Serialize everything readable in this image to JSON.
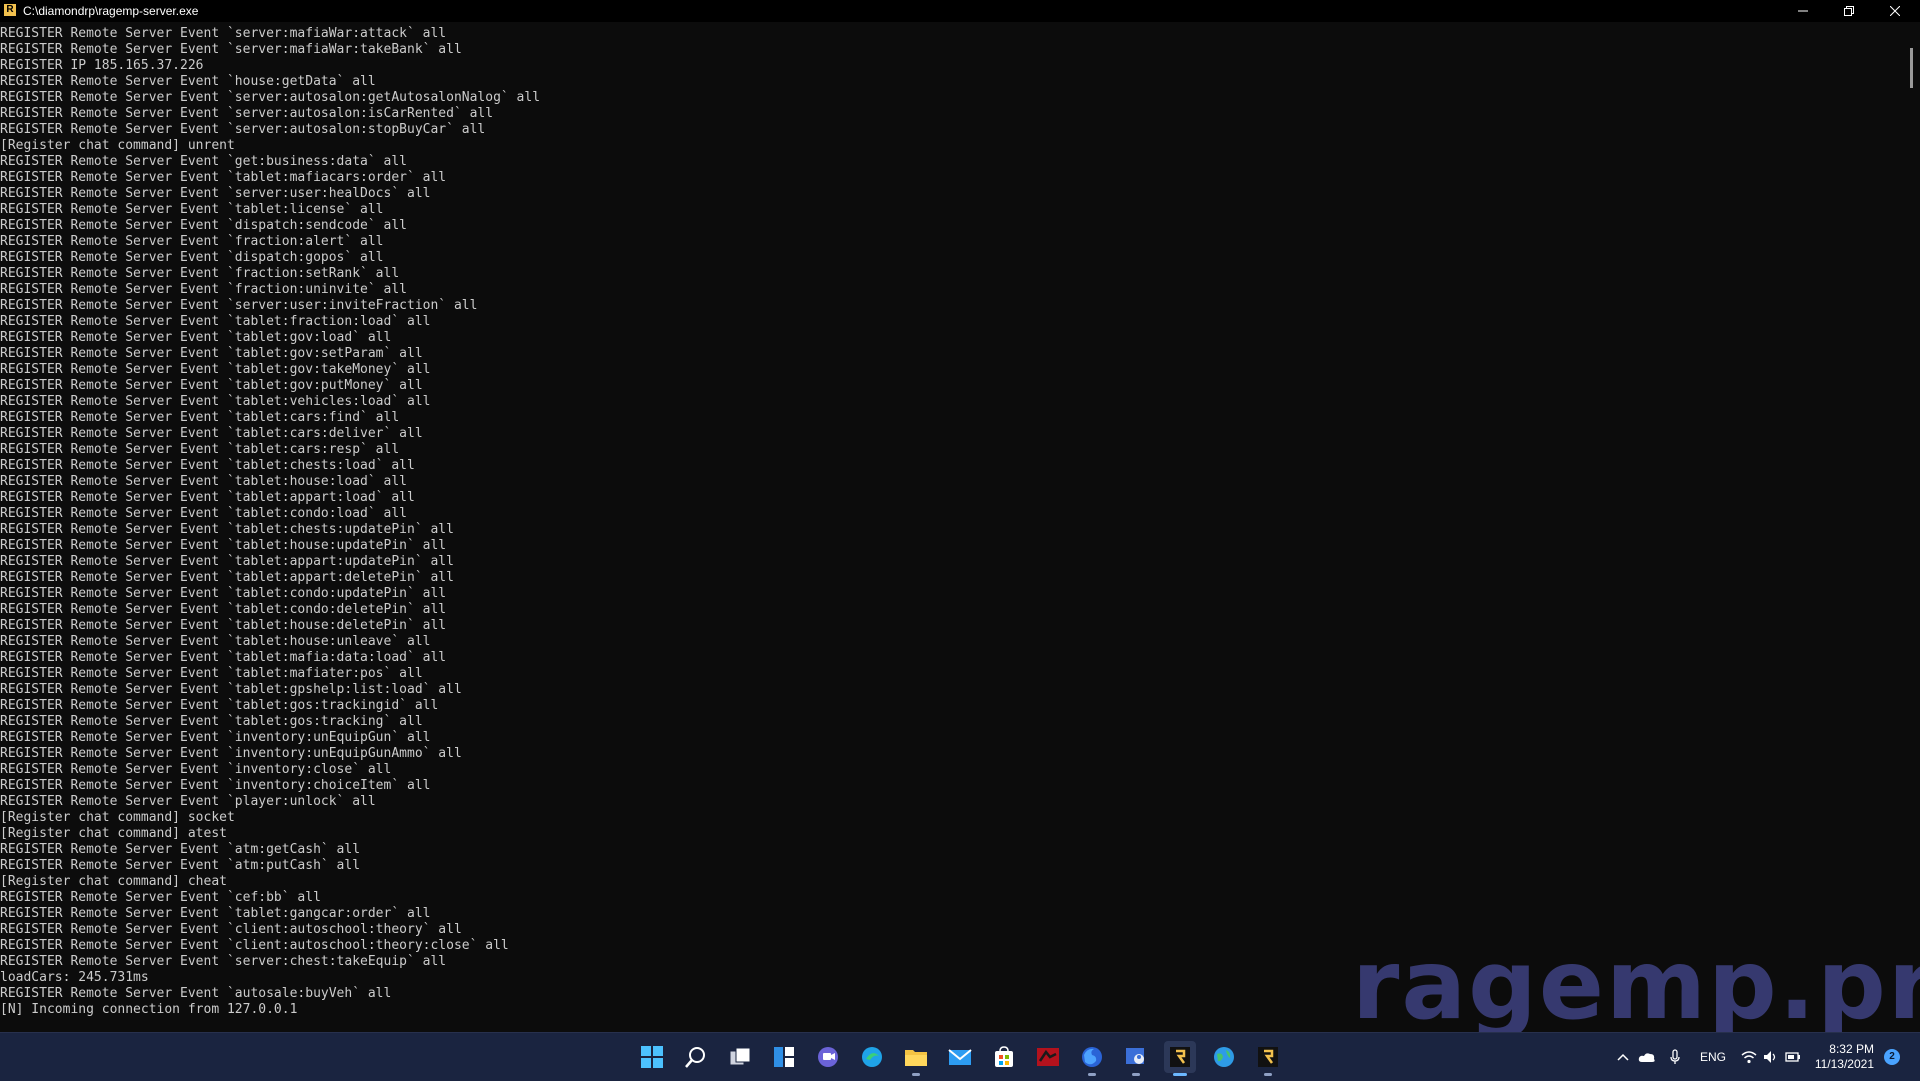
{
  "window": {
    "title": "C:\\diamondrp\\ragemp-server.exe",
    "controls": {
      "minimize": "minimize-icon",
      "restore": "restore-icon",
      "close": "close-icon"
    }
  },
  "console": {
    "lines": [
      "REGISTER Remote Server Event `server:mafiaWar:attack` all",
      "REGISTER Remote Server Event `server:mafiaWar:takeBank` all",
      "REGISTER IP 185.165.37.226",
      "REGISTER Remote Server Event `house:getData` all",
      "REGISTER Remote Server Event `server:autosalon:getAutosalonNalog` all",
      "REGISTER Remote Server Event `server:autosalon:isCarRented` all",
      "REGISTER Remote Server Event `server:autosalon:stopBuyCar` all",
      "[Register chat command] unrent",
      "REGISTER Remote Server Event `get:business:data` all",
      "REGISTER Remote Server Event `tablet:mafiacars:order` all",
      "REGISTER Remote Server Event `server:user:healDocs` all",
      "REGISTER Remote Server Event `tablet:license` all",
      "REGISTER Remote Server Event `dispatch:sendcode` all",
      "REGISTER Remote Server Event `fraction:alert` all",
      "REGISTER Remote Server Event `dispatch:gopos` all",
      "REGISTER Remote Server Event `fraction:setRank` all",
      "REGISTER Remote Server Event `fraction:uninvite` all",
      "REGISTER Remote Server Event `server:user:inviteFraction` all",
      "REGISTER Remote Server Event `tablet:fraction:load` all",
      "REGISTER Remote Server Event `tablet:gov:load` all",
      "REGISTER Remote Server Event `tablet:gov:setParam` all",
      "REGISTER Remote Server Event `tablet:gov:takeMoney` all",
      "REGISTER Remote Server Event `tablet:gov:putMoney` all",
      "REGISTER Remote Server Event `tablet:vehicles:load` all",
      "REGISTER Remote Server Event `tablet:cars:find` all",
      "REGISTER Remote Server Event `tablet:cars:deliver` all",
      "REGISTER Remote Server Event `tablet:cars:resp` all",
      "REGISTER Remote Server Event `tablet:chests:load` all",
      "REGISTER Remote Server Event `tablet:house:load` all",
      "REGISTER Remote Server Event `tablet:appart:load` all",
      "REGISTER Remote Server Event `tablet:condo:load` all",
      "REGISTER Remote Server Event `tablet:chests:updatePin` all",
      "REGISTER Remote Server Event `tablet:house:updatePin` all",
      "REGISTER Remote Server Event `tablet:appart:updatePin` all",
      "REGISTER Remote Server Event `tablet:appart:deletePin` all",
      "REGISTER Remote Server Event `tablet:condo:updatePin` all",
      "REGISTER Remote Server Event `tablet:condo:deletePin` all",
      "REGISTER Remote Server Event `tablet:house:deletePin` all",
      "REGISTER Remote Server Event `tablet:house:unleave` all",
      "REGISTER Remote Server Event `tablet:mafia:data:load` all",
      "REGISTER Remote Server Event `tablet:mafiater:pos` all",
      "REGISTER Remote Server Event `tablet:gpshelp:list:load` all",
      "REGISTER Remote Server Event `tablet:gos:trackingid` all",
      "REGISTER Remote Server Event `tablet:gos:tracking` all",
      "REGISTER Remote Server Event `inventory:unEquipGun` all",
      "REGISTER Remote Server Event `inventory:unEquipGunAmmo` all",
      "REGISTER Remote Server Event `inventory:close` all",
      "REGISTER Remote Server Event `inventory:choiceItem` all",
      "REGISTER Remote Server Event `player:unlock` all",
      "[Register chat command] socket",
      "[Register chat command] atest",
      "REGISTER Remote Server Event `atm:getCash` all",
      "REGISTER Remote Server Event `atm:putCash` all",
      "[Register chat command] cheat",
      "REGISTER Remote Server Event `cef:bb` all",
      "REGISTER Remote Server Event `tablet:gangcar:order` all",
      "REGISTER Remote Server Event `client:autoschool:theory` all",
      "REGISTER Remote Server Event `client:autoschool:theory:close` all",
      "REGISTER Remote Server Event `server:chest:takeEquip` all",
      "loadCars: 245.731ms",
      "REGISTER Remote Server Event `autosale:buyVeh` all",
      "[N] Incoming connection from 127.0.0.1"
    ]
  },
  "watermark": {
    "text": "ragemp.pro"
  },
  "taskbar": {
    "icons": [
      {
        "name": "start-icon",
        "active": false
      },
      {
        "name": "search-icon",
        "active": false
      },
      {
        "name": "task-view-icon",
        "active": false
      },
      {
        "name": "widgets-icon",
        "active": false
      },
      {
        "name": "chat-icon",
        "active": false
      },
      {
        "name": "edge-icon",
        "active": false
      },
      {
        "name": "file-explorer-icon",
        "active": false
      },
      {
        "name": "mail-icon",
        "active": false
      },
      {
        "name": "store-icon",
        "active": false
      },
      {
        "name": "app-red-icon",
        "active": false
      },
      {
        "name": "firefox-icon",
        "active": false
      },
      {
        "name": "app-user-icon",
        "active": false
      },
      {
        "name": "ragemp-icon",
        "active": true
      },
      {
        "name": "globe-icon",
        "active": false
      },
      {
        "name": "ragemp-second-icon",
        "active": false
      }
    ],
    "tray": {
      "language": "ENG",
      "time": "8:32 PM",
      "date": "11/13/2021",
      "notification_count": "2"
    }
  },
  "colors": {
    "console_bg": "#0c0c0c",
    "console_text": "#cccccc",
    "taskbar_bg": "#1a2440",
    "watermark": "#3a3d78"
  }
}
